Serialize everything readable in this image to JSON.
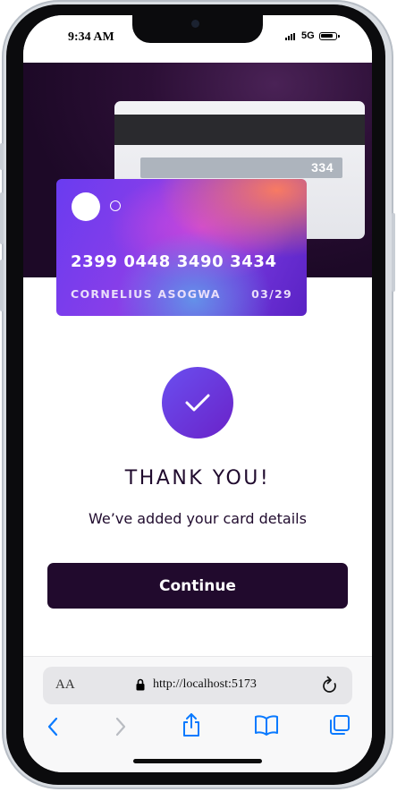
{
  "status_bar": {
    "time": "9:34 AM",
    "network": "5G"
  },
  "card": {
    "cvv": "334",
    "number": "2399 0448 3490 3434",
    "holder": "CORNELIUS ASOGWA",
    "expiry": "03/29"
  },
  "confirmation": {
    "title": "THANK YOU!",
    "message": "We’ve added your card details",
    "continue_label": "Continue"
  },
  "browser": {
    "text_size_label": "AA",
    "url": "http://localhost:5173",
    "toolbar_icons": [
      "back-icon",
      "forward-icon",
      "share-icon",
      "bookmarks-icon",
      "tabs-icon"
    ]
  },
  "colors": {
    "brand_dark": "#210a2d",
    "accent_purple": "#6a4ff0",
    "safari_blue": "#0a7aff"
  }
}
